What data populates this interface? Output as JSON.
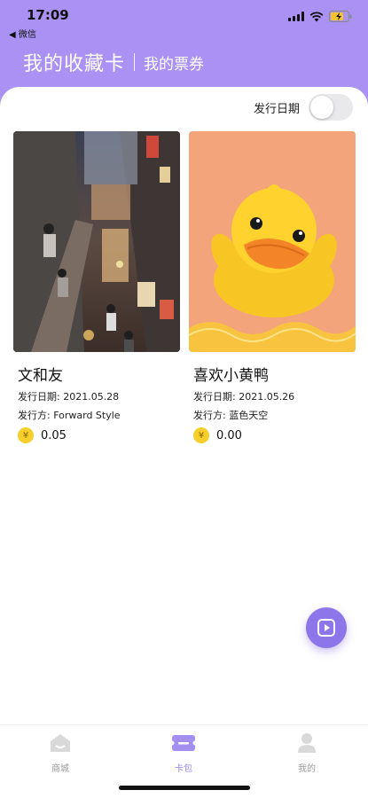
{
  "status_bar": {
    "time": "17:09",
    "back_app": "◀ 微信"
  },
  "header": {
    "title": "我的收藏卡",
    "subtitle": "我的票券"
  },
  "filter": {
    "label": "发行日期",
    "toggle_on": false
  },
  "cards": [
    {
      "title": "文和友",
      "date_line": "发行日期: 2021.05.28",
      "issuer_line": "发行方: Forward Style",
      "currency_icon": "¥",
      "price": "0.05"
    },
    {
      "title": "喜欢小黄鸭",
      "date_line": "发行日期: 2021.05.26",
      "issuer_line": "发行方: 蓝色天空",
      "currency_icon": "¥",
      "price": "0.00"
    }
  ],
  "tabs": [
    {
      "label": "商城",
      "icon": "shop-icon",
      "active": false
    },
    {
      "label": "卡包",
      "icon": "card-wallet-icon",
      "active": true
    },
    {
      "label": "我的",
      "icon": "user-icon",
      "active": false
    }
  ],
  "colors": {
    "accent": "#a992f3",
    "tab_active": "#9a86ee",
    "tab_inactive": "#999999",
    "coin": "#f6cf2d"
  }
}
